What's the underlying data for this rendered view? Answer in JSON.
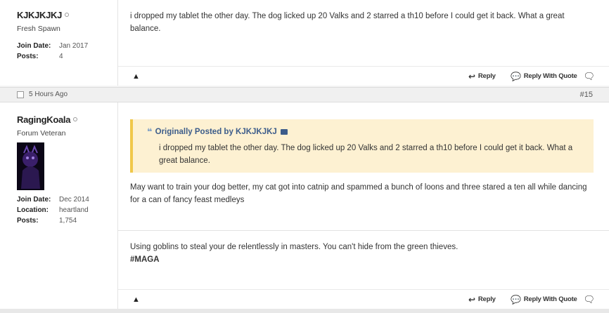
{
  "post1": {
    "username": "KJKJKJKJ",
    "usertitle": "Fresh Spawn",
    "stats": [
      {
        "label": "Join Date:",
        "value": "Jan 2017"
      },
      {
        "label": "Posts:",
        "value": "4"
      }
    ],
    "message": "i dropped my tablet the other day. The dog licked up 20 Valks and 2 starred a th10 before I could get it back. What a great balance.",
    "actions": {
      "reply": "Reply",
      "reply_quote": "Reply With Quote"
    }
  },
  "post2_header": {
    "time": "5 Hours Ago",
    "number": "#15"
  },
  "post2": {
    "username": "RagingKoala",
    "usertitle": "Forum Veteran",
    "stats": [
      {
        "label": "Join Date:",
        "value": "Dec 2014"
      },
      {
        "label": "Location:",
        "value": "heartland"
      },
      {
        "label": "Posts:",
        "value": "1,754"
      }
    ],
    "quote": {
      "header": "Originally Posted by KJKJKJKJ",
      "text": "i dropped my tablet the other day. The dog licked up 20 Valks and 2 starred a th10 before I could get it back. What a great balance."
    },
    "message": "May want to train your dog better, my cat got into catnip and spammed a bunch of loons and three stared a ten all while dancing for a can of fancy feast medleys",
    "signature_line1": "Using goblins to steal your de relentlessly in masters. You can't hide from the green thieves.",
    "signature_line2": "#MAGA",
    "actions": {
      "reply": "Reply",
      "reply_quote": "Reply With Quote"
    }
  },
  "colors": {
    "quote_bg": "#fdf1d2",
    "quote_border": "#f0c84a",
    "quote_header": "#3c5c8a"
  },
  "icons": [
    "warning-icon",
    "reply-icon",
    "reply-quote-icon",
    "multiquote-icon",
    "quote-marks-icon",
    "view-post-icon"
  ]
}
